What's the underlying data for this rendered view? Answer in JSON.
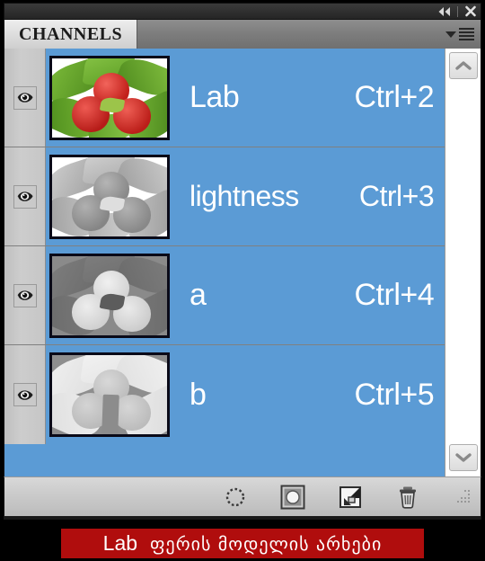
{
  "window": {
    "collapse_icon": "double-left-arrow-icon",
    "close_icon": "close-x-icon"
  },
  "panel": {
    "tab_label": "CHANNELS",
    "menu_icon": "panel-menu-icon"
  },
  "channels": [
    {
      "name": "Lab",
      "shortcut": "Ctrl+2",
      "visible": true,
      "selected": true,
      "thumbnail": "strawberries-color",
      "eye_icon": "eye-icon"
    },
    {
      "name": "lightness",
      "shortcut": "Ctrl+3",
      "visible": true,
      "selected": true,
      "thumbnail": "strawberries-lightness",
      "eye_icon": "eye-icon"
    },
    {
      "name": "a",
      "shortcut": "Ctrl+4",
      "visible": true,
      "selected": true,
      "thumbnail": "strawberries-a-channel",
      "eye_icon": "eye-icon"
    },
    {
      "name": "b",
      "shortcut": "Ctrl+5",
      "visible": true,
      "selected": true,
      "thumbnail": "strawberries-b-channel",
      "eye_icon": "eye-icon"
    }
  ],
  "scrollbar": {
    "up_icon": "chevron-up-icon",
    "down_icon": "chevron-down-icon"
  },
  "toolbar": {
    "buttons": [
      {
        "icon": "load-channel-as-selection-icon"
      },
      {
        "icon": "save-selection-as-channel-icon"
      },
      {
        "icon": "new-channel-icon"
      },
      {
        "icon": "delete-channel-icon"
      }
    ],
    "resize_grip_icon": "resize-grip-icon"
  },
  "caption": {
    "latin": "Lab",
    "georgian": "ფერის მოდელის არხები"
  },
  "colors": {
    "selection_blue": "#5b9bd5",
    "caption_red": "#b00d0d",
    "panel_gray": "#c9c9c9",
    "frame_black": "#000000"
  }
}
